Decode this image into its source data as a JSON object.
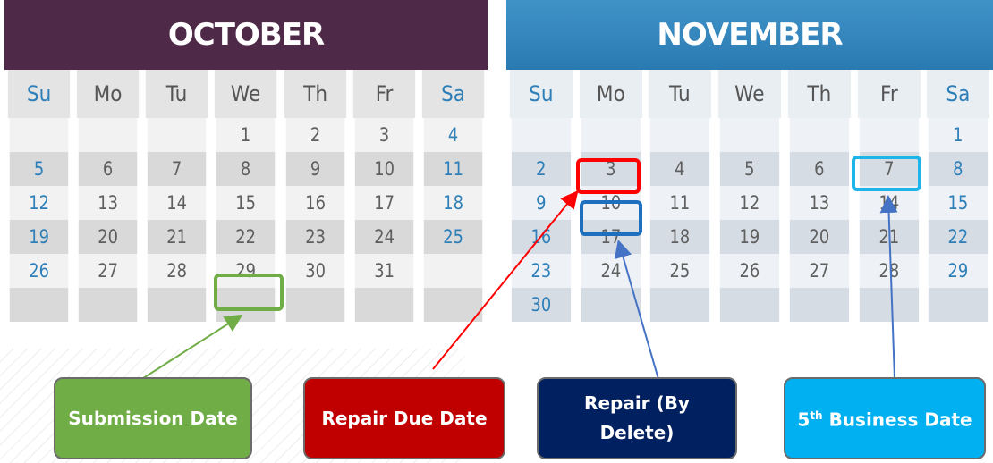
{
  "october": {
    "title": "OCTOBER",
    "weekday_headers": [
      "Su",
      "Mo",
      "Tu",
      "We",
      "Th",
      "Fr",
      "Sa"
    ],
    "weeks": [
      [
        "",
        "",
        "",
        "1",
        "2",
        "3",
        "4"
      ],
      [
        "5",
        "6",
        "7",
        "8",
        "9",
        "10",
        "11"
      ],
      [
        "12",
        "13",
        "14",
        "15",
        "16",
        "17",
        "18"
      ],
      [
        "19",
        "20",
        "21",
        "22",
        "23",
        "24",
        "25"
      ],
      [
        "26",
        "27",
        "28",
        "29",
        "30",
        "31",
        ""
      ],
      [
        "",
        "",
        "",
        "",
        "",
        "",
        ""
      ]
    ]
  },
  "november": {
    "title": "NOVEMBER",
    "weekday_headers": [
      "Su",
      "Mo",
      "Tu",
      "We",
      "Th",
      "Fr",
      "Sa"
    ],
    "weeks": [
      [
        "",
        "",
        "",
        "",
        "",
        "",
        "1"
      ],
      [
        "2",
        "3",
        "4",
        "5",
        "6",
        "7",
        "8"
      ],
      [
        "9",
        "10",
        "11",
        "12",
        "13",
        "14",
        "15"
      ],
      [
        "16",
        "17",
        "18",
        "19",
        "20",
        "21",
        "22"
      ],
      [
        "23",
        "24",
        "25",
        "26",
        "27",
        "28",
        "29"
      ],
      [
        "30",
        "",
        "",
        "",
        "",
        "",
        ""
      ]
    ]
  },
  "legend": {
    "submission": {
      "label": "Submission Date",
      "highlighted_date": "October 29",
      "color": "#70ad47"
    },
    "repair_due": {
      "label": "Repair Due Date",
      "highlighted_date": "November 3",
      "color": "#c00000"
    },
    "repair_by_delete": {
      "label": "Repair (By Delete)",
      "highlighted_date": "November 10",
      "color": "#002060"
    },
    "fifth_business": {
      "label_superscript_number": "5",
      "label_superscript": "th",
      "label_rest": "Business Date",
      "highlighted_date": "November 7",
      "color": "#00b0f0"
    }
  },
  "colors": {
    "october_bar": "#4e2a48",
    "november_bar": "#2a7ab2",
    "weekend_text": "#2e7fb8",
    "highlight_blue_box": "#1f6fbf"
  }
}
